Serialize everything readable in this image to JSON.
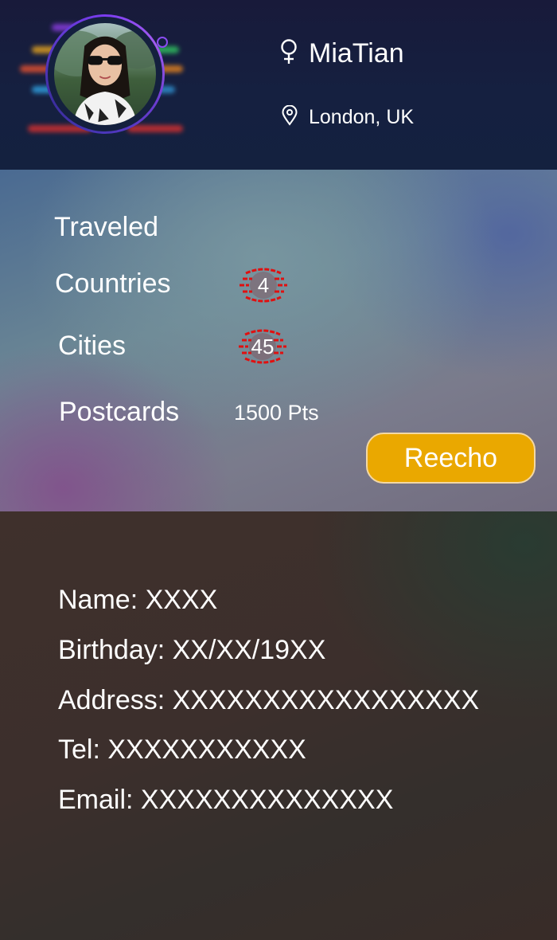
{
  "profile": {
    "name": "MiaTian",
    "location": "London, UK"
  },
  "stats": {
    "traveled_label": "Traveled",
    "countries_label": "Countries",
    "countries_value": "4",
    "cities_label": "Cities",
    "cities_value": "45",
    "postcards_label": "Postcards",
    "postcards_value": "1500 Pts",
    "reecho_label": "Reecho"
  },
  "info": {
    "name": "Name: XXXX",
    "birthday": "Birthday: XX/XX/19XX",
    "address": "Address: XXXXXXXXXXXXXXXXX",
    "tel": "Tel: XXXXXXXXXXX",
    "email": "Email: XXXXXXXXXXXXXX"
  },
  "icons": {
    "gender": "female-icon",
    "location": "map-pin-icon"
  },
  "colors": {
    "accent_button": "#eaa800",
    "badge_red": "#e01010",
    "avatar_ring": "#7b3cf0"
  }
}
